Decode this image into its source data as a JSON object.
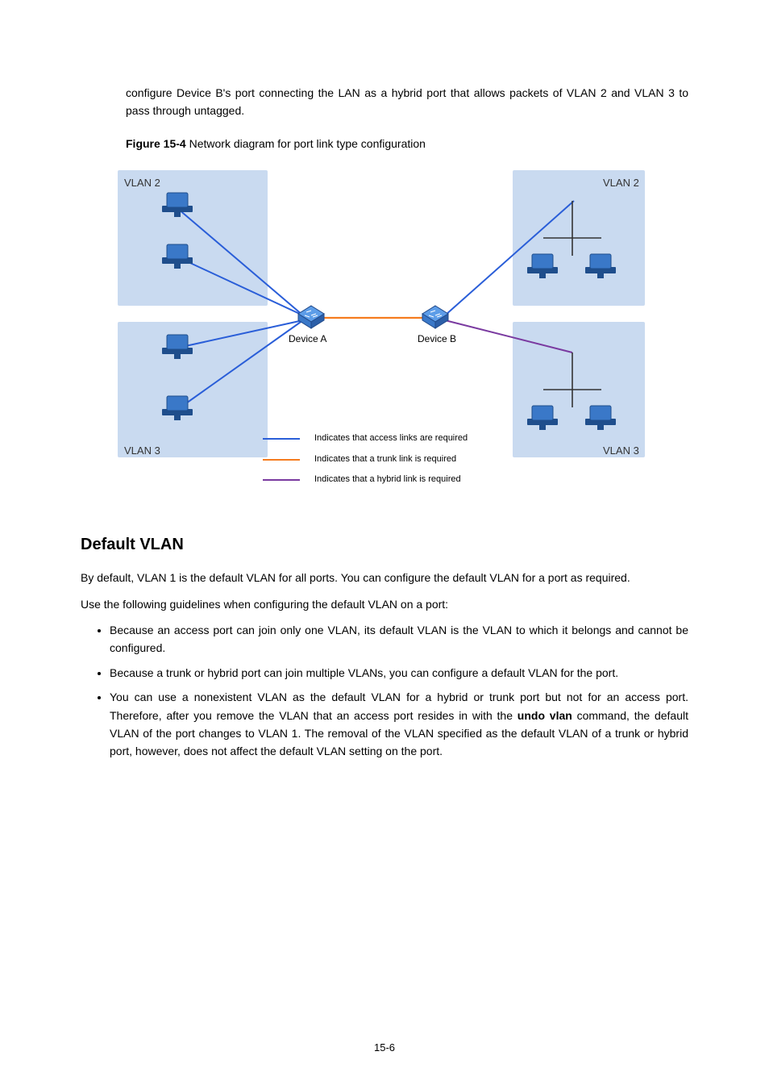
{
  "intro": "configure Device B's port connecting the LAN as a hybrid port that allows packets of VLAN 2 and VLAN 3 to pass through untagged.",
  "figure": {
    "number": "Figure 15-4",
    "caption": "Network diagram for port link type configuration"
  },
  "diagram": {
    "labels": {
      "vlan2_tl": "VLAN 2",
      "vlan3_bl": "VLAN 3",
      "vlan2_tr": "VLAN 2",
      "vlan3_br": "VLAN 3",
      "device_a": "Device A",
      "device_b": "Device B"
    },
    "legend": {
      "access": "Indicates that access links are required",
      "trunk": "Indicates that a trunk link is required",
      "hybrid": "Indicates that a hybrid link is required"
    }
  },
  "section_heading": "Default VLAN",
  "para1": "By default, VLAN 1 is the default VLAN for all ports. You can configure the default VLAN for a port as required.",
  "para2": "Use the following guidelines when configuring the default VLAN on a port:",
  "bullets": {
    "b1": "Because an access port can join only one VLAN, its default VLAN is the VLAN to which it belongs and cannot be configured.",
    "b2": "Because a trunk or hybrid port can join multiple VLANs, you can configure a default VLAN for the port.",
    "b3_pre": "You can use a nonexistent VLAN as the default VLAN for a hybrid or trunk port but not for an access port. Therefore, after you remove the VLAN that an access port resides in with the ",
    "b3_cmd": "undo vlan",
    "b3_post": " command, the default VLAN of the port changes to VLAN 1. The removal of the VLAN specified as the default VLAN of a trunk or hybrid port, however, does not affect the default VLAN setting on the port."
  },
  "page_number": "15-6"
}
